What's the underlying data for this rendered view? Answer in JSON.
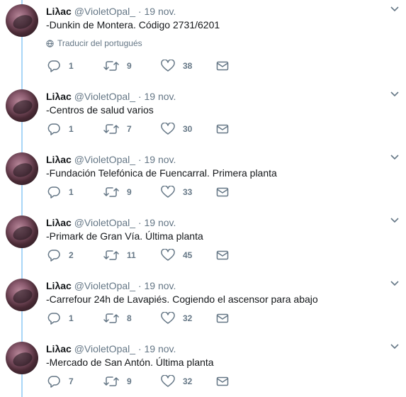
{
  "tweets": [
    {
      "name": "Liλac",
      "handle": "@VioletOpal_",
      "dot": "·",
      "date": "19 nov.",
      "text": "-Dunkin de Montera. Código 2731/6201",
      "translate": "Traducir del portugués",
      "replies": "1",
      "retweets": "9",
      "likes": "38"
    },
    {
      "name": "Liλac",
      "handle": "@VioletOpal_",
      "dot": "·",
      "date": "19 nov.",
      "text": "-Centros de salud varios",
      "replies": "1",
      "retweets": "7",
      "likes": "30"
    },
    {
      "name": "Liλac",
      "handle": "@VioletOpal_",
      "dot": "·",
      "date": "19 nov.",
      "text": "-Fundación Telefónica de Fuencarral. Primera planta",
      "replies": "1",
      "retweets": "9",
      "likes": "33"
    },
    {
      "name": "Liλac",
      "handle": "@VioletOpal_",
      "dot": "·",
      "date": "19 nov.",
      "text": "-Primark de Gran Vía. Última planta",
      "replies": "2",
      "retweets": "11",
      "likes": "45"
    },
    {
      "name": "Liλac",
      "handle": "@VioletOpal_",
      "dot": "·",
      "date": "19 nov.",
      "text": "-Carrefour 24h de Lavapiés. Cogiendo el ascensor para abajo",
      "replies": "1",
      "retweets": "8",
      "likes": "32"
    },
    {
      "name": "Liλac",
      "handle": "@VioletOpal_",
      "dot": "·",
      "date": "19 nov.",
      "text": "-Mercado de San Antón. Última planta",
      "replies": "7",
      "retweets": "9",
      "likes": "32"
    }
  ],
  "icons": {
    "reply": "reply-icon",
    "retweet": "retweet-icon",
    "like": "heart-icon",
    "dm": "envelope-icon",
    "menu": "chevron-down-icon",
    "globe": "globe-icon"
  },
  "colors": {
    "muted": "#657786",
    "text": "#14171a",
    "thread_line": "#a9d6f7"
  }
}
